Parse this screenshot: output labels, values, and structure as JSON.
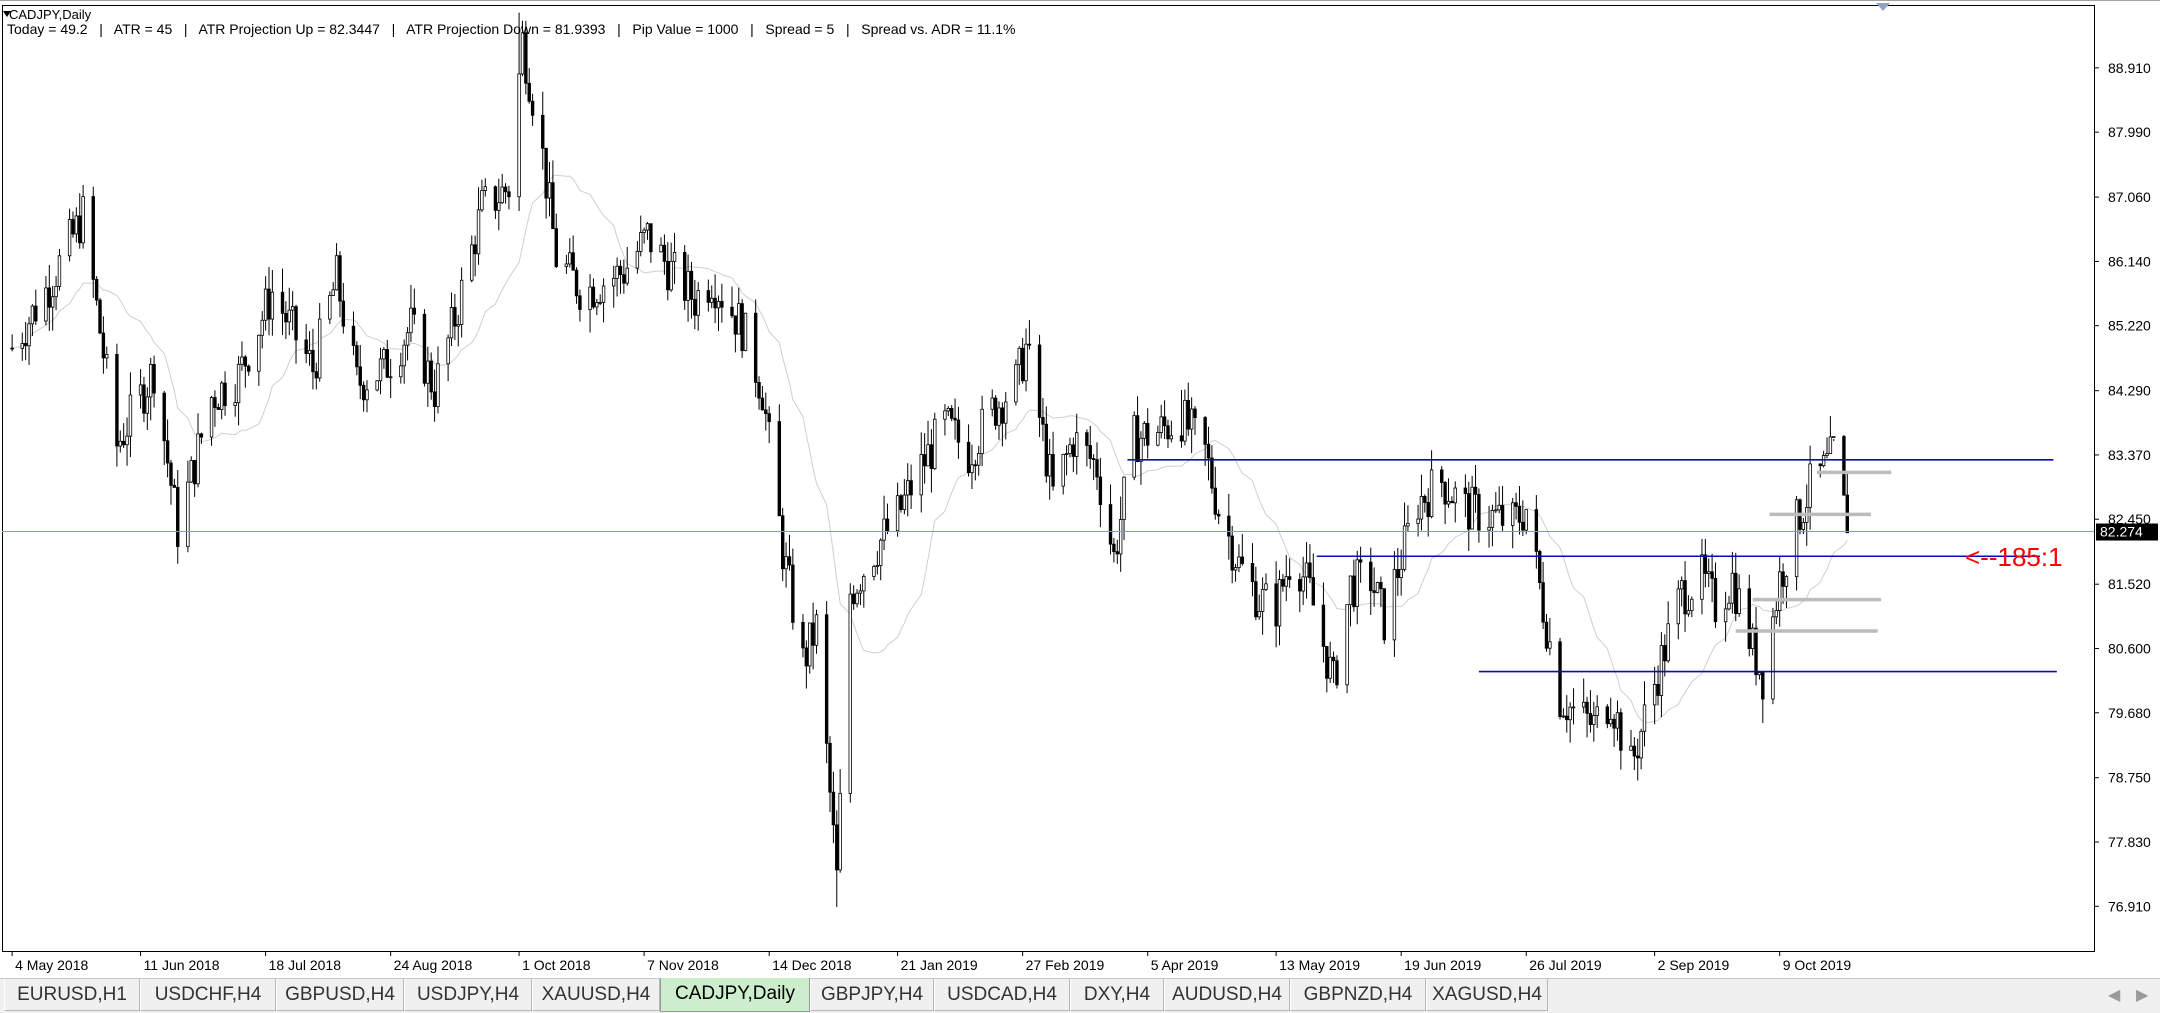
{
  "window": {
    "symbol_title": "CADJPY,Daily",
    "info_line": "Today = 49.2   |   ATR = 45   |   ATR Projection Up = 82.3447   |   ATR Projection Down = 81.9393   |   Pip Value = 1000   |   Spread = 5   |   Spread vs. ADR = 11.1%"
  },
  "colors": {
    "candle": "#000000",
    "sr_line": "#0b0bb5",
    "grey_level": "#bcbcbc",
    "price_line": "#7f9fbf",
    "price_label_bg": "#000000",
    "annotation": "#ff0000",
    "ma": "#cfcfcf",
    "active_tab": "#cdeecd"
  },
  "chart_data": {
    "type": "candlestick",
    "symbol": "CADJPY",
    "timeframe": "Daily",
    "y_ticks": [
      "88.910",
      "87.990",
      "87.060",
      "86.140",
      "85.220",
      "84.290",
      "83.370",
      "82.450",
      "81.520",
      "80.600",
      "79.680",
      "78.750",
      "77.830",
      "76.910"
    ],
    "ylim": [
      76.27,
      89.81
    ],
    "current_price": "82.274",
    "x_tick_labels": [
      "4 May 2018",
      "11 Jun 2018",
      "18 Jul 2018",
      "24 Aug 2018",
      "1 Oct 2018",
      "7 Nov 2018",
      "14 Dec 2018",
      "21 Jan 2019",
      "27 Feb 2019",
      "5 Apr 2019",
      "13 May 2019",
      "19 Jun 2019",
      "26 Jul 2019",
      "2 Sep 2019",
      "9 Oct 2019"
    ],
    "close_path": [
      [
        "4 May 2018",
        84.9
      ],
      [
        "15 May 2018",
        85.8
      ],
      [
        "25 May 2018",
        86.8
      ],
      [
        "4 Jun 2018",
        83.5
      ],
      [
        "15 Jun 2018",
        84.6
      ],
      [
        "22 Jun 2018",
        82.3
      ],
      [
        "2 Jul 2018",
        84.2
      ],
      [
        "10 Jul 2018",
        84.5
      ],
      [
        "20 Jul 2018",
        85.7
      ],
      [
        "1 Aug 2018",
        84.6
      ],
      [
        "8 Aug 2018",
        85.9
      ],
      [
        "14 Aug 2018",
        84.4
      ],
      [
        "22 Aug 2018",
        84.6
      ],
      [
        "30 Aug 2018",
        85.2
      ],
      [
        "6 Sep 2018",
        84.3
      ],
      [
        "13 Sep 2018",
        85.5
      ],
      [
        "20 Sep 2018",
        86.9
      ],
      [
        "28 Sep 2018",
        87.2
      ],
      [
        "2 Oct 2018",
        89.3
      ],
      [
        "7 Oct 2018",
        88.0
      ],
      [
        "12 Oct 2018",
        86.2
      ],
      [
        "20 Oct 2018",
        85.7
      ],
      [
        "1 Nov 2018",
        86.0
      ],
      [
        "8 Nov 2018",
        86.5
      ],
      [
        "15 Nov 2018",
        86.0
      ],
      [
        "22 Nov 2018",
        85.6
      ],
      [
        "27 Nov 2018",
        85.9
      ],
      [
        "6 Dec 2018",
        85.2
      ],
      [
        "12 Dec 2018",
        84.3
      ],
      [
        "18 Dec 2018",
        82.0
      ],
      [
        "24 Dec 2018",
        80.4
      ],
      [
        "28 Dec 2018",
        80.9
      ],
      [
        "3 Jan 2019",
        77.3
      ],
      [
        "7 Jan 2019",
        81.4
      ],
      [
        "14 Jan 2019",
        82.0
      ],
      [
        "21 Jan 2019",
        82.5
      ],
      [
        "28 Jan 2019",
        83.2
      ],
      [
        "4 Feb 2019",
        83.8
      ],
      [
        "11 Feb 2019",
        83.4
      ],
      [
        "18 Feb 2019",
        84.0
      ],
      [
        "25 Feb 2019",
        84.4
      ],
      [
        "28 Feb 2019",
        84.9
      ],
      [
        "4 Mar 2019",
        83.9
      ],
      [
        "8 Mar 2019",
        82.8
      ],
      [
        "14 Mar 2019",
        83.6
      ],
      [
        "21 Mar 2019",
        83.2
      ],
      [
        "26 Mar 2019",
        81.9
      ],
      [
        "1 Apr 2019",
        83.6
      ],
      [
        "8 Apr 2019",
        83.7
      ],
      [
        "15 Apr 2019",
        83.9
      ],
      [
        "22 Apr 2019",
        83.4
      ],
      [
        "26 Apr 2019",
        82.6
      ],
      [
        "2 May 2019",
        81.8
      ],
      [
        "8 May 2019",
        81.3
      ],
      [
        "13 May 2019",
        81.2
      ],
      [
        "18 May 2019",
        82.0
      ],
      [
        "23 May 2019",
        81.4
      ],
      [
        "30 May 2019",
        80.1
      ],
      [
        "4 Jun 2019",
        81.5
      ],
      [
        "10 Jun 2019",
        81.6
      ],
      [
        "14 Jun 2019",
        81.0
      ],
      [
        "19 Jun 2019",
        81.9
      ],
      [
        "24 Jun 2019",
        82.7
      ],
      [
        "1 Jul 2019",
        83.0
      ],
      [
        "8 Jul 2019",
        82.6
      ],
      [
        "15 Jul 2019",
        82.5
      ],
      [
        "22 Jul 2019",
        82.4
      ],
      [
        "26 Jul 2019",
        82.6
      ],
      [
        "31 Jul 2019",
        81.2
      ],
      [
        "5 Aug 2019",
        79.9
      ],
      [
        "9 Aug 2019",
        79.7
      ],
      [
        "15 Aug 2019",
        79.5
      ],
      [
        "20 Aug 2019",
        79.9
      ],
      [
        "26 Aug 2019",
        78.9
      ],
      [
        "30 Aug 2019",
        79.6
      ],
      [
        "5 Sep 2019",
        80.6
      ],
      [
        "10 Sep 2019",
        81.4
      ],
      [
        "16 Sep 2019",
        81.6
      ],
      [
        "20 Sep 2019",
        81.2
      ],
      [
        "25 Sep 2019",
        81.6
      ],
      [
        "1 Oct 2019",
        80.6
      ],
      [
        "4 Oct 2019",
        80.2
      ],
      [
        "9 Oct 2019",
        81.6
      ],
      [
        "14 Oct 2019",
        82.4
      ],
      [
        "18 Oct 2019",
        82.9
      ],
      [
        "23 Oct 2019",
        83.2
      ],
      [
        "25 Oct 2019",
        83.4
      ],
      [
        "28 Oct 2019",
        82.6
      ],
      [
        "30 Oct 2019",
        82.3
      ]
    ],
    "horizontal_levels": [
      {
        "price": 83.3,
        "from": "30 Mar 2019",
        "to": "29 Dec 2019",
        "style": "sr"
      },
      {
        "price": 81.92,
        "from": "25 May 2019",
        "to": "25 Dec 2019",
        "style": "sr"
      },
      {
        "price": 80.27,
        "from": "12 Jul 2019",
        "to": "30 Dec 2019",
        "style": "sr"
      },
      {
        "price": 83.12,
        "from": "20 Oct 2019",
        "to": "11 Nov 2019",
        "style": "grey"
      },
      {
        "price": 82.52,
        "from": "6 Oct 2019",
        "to": "5 Nov 2019",
        "style": "grey"
      },
      {
        "price": 81.3,
        "from": "1 Oct 2019",
        "to": "8 Nov 2019",
        "style": "grey"
      },
      {
        "price": 80.85,
        "from": "26 Sep 2019",
        "to": "7 Nov 2019",
        "style": "grey"
      }
    ],
    "annotation": "<--185:1"
  },
  "tabs": [
    {
      "label": "EURUSD,H1"
    },
    {
      "label": "USDCHF,H4"
    },
    {
      "label": "GBPUSD,H4"
    },
    {
      "label": "USDJPY,H4"
    },
    {
      "label": "XAUUSD,H4"
    },
    {
      "label": "CADJPY,Daily",
      "active": true
    },
    {
      "label": "GBPJPY,H4"
    },
    {
      "label": "USDCAD,H4"
    },
    {
      "label": "DXY,H4"
    },
    {
      "label": "AUDUSD,H4"
    },
    {
      "label": "GBPNZD,H4"
    },
    {
      "label": "XAGUSD,H4"
    }
  ],
  "tab_scroll": {
    "left": "◀",
    "right": "▶"
  }
}
